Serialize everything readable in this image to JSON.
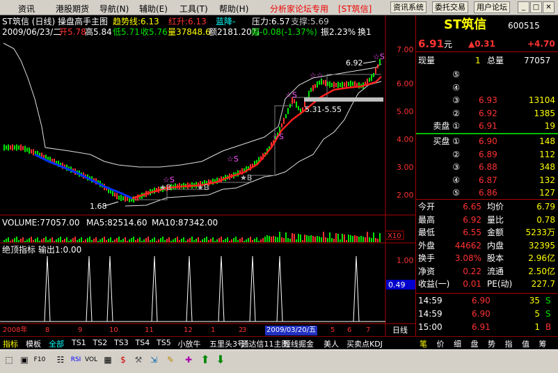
{
  "menu": {
    "items": [
      "资讯",
      "港股期货",
      "导航(N)",
      "辅助(E)",
      "工具(T)",
      "帮助(H)"
    ],
    "forum": "分析家论坛专用",
    "stock_tag": "[ST筑信]",
    "buttons": [
      "资讯系统",
      "委托交易",
      "用户论坛"
    ]
  },
  "chart": {
    "title": "ST筑信 (日线) 操盘高手主图",
    "trend_label": "趋势线:6.13",
    "red_label": "红升:6.13",
    "blue_label": "蓝降-",
    "pressure": "压力:6.57",
    "support": "支撑:5.69",
    "date": "2009/06/23/二",
    "open": "开5.78",
    "high": "高5.84",
    "low": "低5.71",
    "close": "收5.76",
    "volume": "量37848.6",
    "amount": "额2181.20万",
    "change": "幅-0.08(-1.37%)",
    "amplitude": "振2.23%",
    "turnover": "换1",
    "price_axis": [
      "7.00",
      "6.00",
      "5.00",
      "4.00",
      "3.00",
      "2.00"
    ],
    "label_high": "6.92",
    "label_low": "1.68",
    "label_range": "5.31-5.55",
    "vol_label": "VOLUME:77057.00",
    "ma5": "MA5:82514.60",
    "ma10": "MA10:87342.00",
    "vol_scale": "X10",
    "ind_label": "绝顶指标 输出1:0.00",
    "ind_axis": [
      "1.00",
      "0.49"
    ],
    "date_axis": [
      "2008年",
      "8",
      "9",
      "10",
      "11",
      "12",
      "1",
      "2",
      "3",
      "2009/03/20/五",
      "5",
      "6",
      "7"
    ],
    "period": "日线"
  },
  "quote": {
    "name": "ST筑信",
    "code": "600515",
    "price": "6.91",
    "yuan": "元",
    "change": "▲0.31",
    "pct": "+4.70",
    "now_label": "现量",
    "now_val": "1",
    "total_label": "总量",
    "total_val": "77057",
    "sell": [
      {
        "n": "⑤",
        "p": "",
        "v": ""
      },
      {
        "n": "④",
        "p": "",
        "v": ""
      },
      {
        "n": "③",
        "p": "6.93",
        "v": "13104"
      },
      {
        "n": "②",
        "p": "6.92",
        "v": "1385"
      },
      {
        "n": "卖盘 ①",
        "p": "6.91",
        "v": "19"
      }
    ],
    "buy": [
      {
        "n": "买盘 ①",
        "p": "6.90",
        "v": "148"
      },
      {
        "n": "②",
        "p": "6.89",
        "v": "112"
      },
      {
        "n": "③",
        "p": "6.88",
        "v": "348"
      },
      {
        "n": "④",
        "p": "6.87",
        "v": "132"
      },
      {
        "n": "⑤",
        "p": "6.86",
        "v": "127"
      }
    ],
    "stats": [
      [
        "今开",
        "6.65",
        "均价",
        "6.79"
      ],
      [
        "最高",
        "6.92",
        "量比",
        "0.78"
      ],
      [
        "最低",
        "6.55",
        "金额",
        "5233万"
      ],
      [
        "外盘",
        "44662",
        "内盘",
        "32395"
      ],
      [
        "换手",
        "3.08%",
        "股本",
        "2.96亿"
      ],
      [
        "净资",
        "0.22",
        "流通",
        "2.50亿"
      ],
      [
        "收益(一)",
        "0.01",
        "PE(动)",
        "227.7"
      ]
    ],
    "ticks": [
      [
        "14:59",
        "6.90",
        "35",
        "S"
      ],
      [
        "14:59",
        "6.90",
        "5",
        "S"
      ],
      [
        "15:00",
        "6.91",
        "1",
        "B"
      ]
    ],
    "bottom_tabs": [
      "笔",
      "价",
      "细",
      "盘",
      "势",
      "指",
      "值",
      "筹"
    ]
  },
  "tabs": [
    "指标",
    "模板",
    "全部",
    "TS1",
    "TS2",
    "TS3",
    "TS4",
    "TS5",
    "小放牛",
    "五里头3号",
    "通达信11主图",
    "短线掘金",
    "美人",
    "买卖点KDJ"
  ],
  "colors": {
    "up": "#ff3232",
    "down": "#00e600",
    "ma": "#ffff00"
  }
}
